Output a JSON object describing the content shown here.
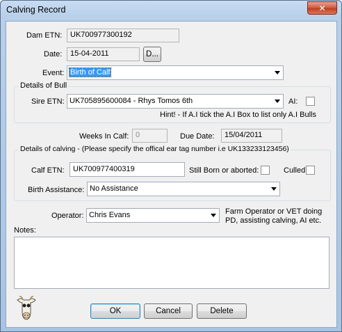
{
  "window": {
    "title": "Calving Record",
    "close_glyph": "✕"
  },
  "dam": {
    "label": "Dam ETN:",
    "value": "UK700977300192"
  },
  "date": {
    "label": "Date:",
    "value": "15-04-2011",
    "picker_label": "D..."
  },
  "event": {
    "label": "Event:",
    "value": "Birth of Calf"
  },
  "bull_group": {
    "title": "Details of Bull",
    "sire_label": "Sire ETN:",
    "sire_value": "UK705895600084 - Rhys Tomos 6th",
    "ai_label": "AI:",
    "hint": "Hint! - If A.I tick the A.I Box to list only A.I Bulls"
  },
  "weeks": {
    "label": "Weeks In Calf:",
    "value": "0"
  },
  "due": {
    "label": "Due Date:",
    "value": "15/04/2011"
  },
  "calving_group": {
    "title": "Details of calving - (Please specify the offical ear tag number i.e UK133233123456)",
    "calf_label": "Calf ETN:",
    "calf_value": "UK700977400319",
    "stillborn_label": "Still Born or aborted:",
    "culled_label": "Culled",
    "assist_label": "Birth Assistance:",
    "assist_value": "No Assistance"
  },
  "operator": {
    "label": "Operator:",
    "value": "Chris Evans",
    "note": "Farm Operator or VET doing PD, assisting calving, AI etc."
  },
  "notes": {
    "label": "Notes:",
    "value": ""
  },
  "buttons": {
    "ok": "OK",
    "cancel": "Cancel",
    "delete": "Delete"
  },
  "icons": {
    "logo": "cow-head-icon"
  }
}
